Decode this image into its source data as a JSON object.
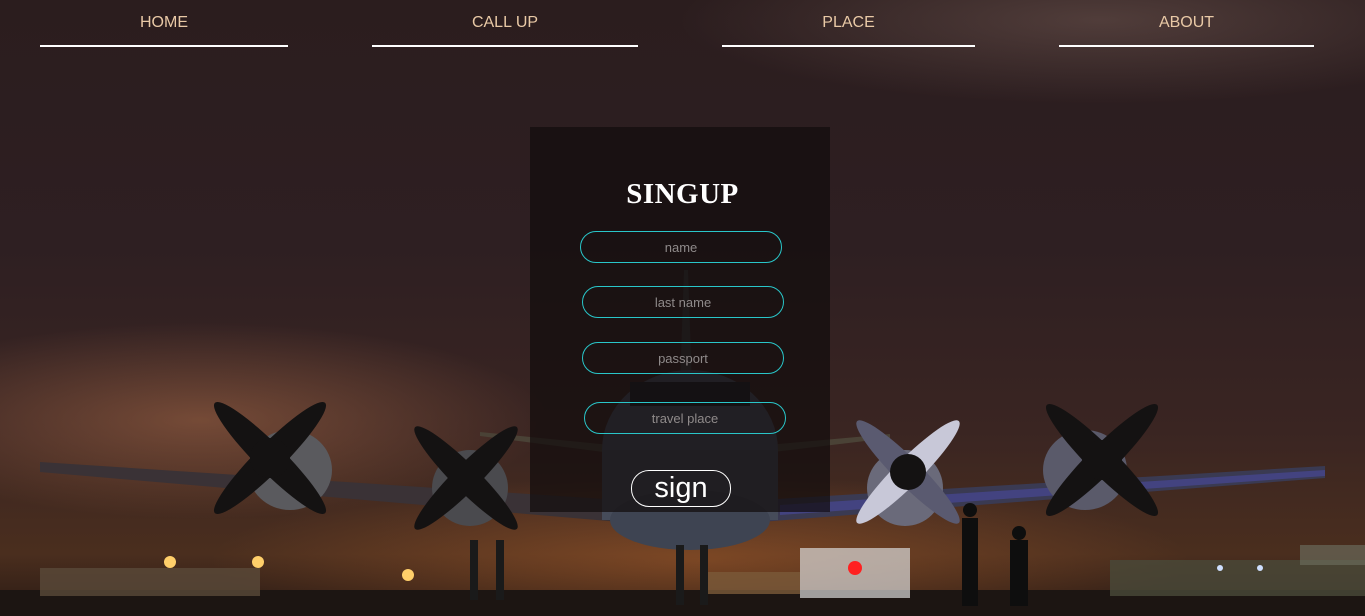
{
  "nav": {
    "items": [
      {
        "label": "HOME"
      },
      {
        "label": "CALL UP"
      },
      {
        "label": "PLACE"
      },
      {
        "label": "ABOUT"
      }
    ]
  },
  "form": {
    "title": "SINGUP",
    "fields": [
      {
        "placeholder": "name",
        "value": ""
      },
      {
        "placeholder": "last name",
        "value": ""
      },
      {
        "placeholder": "passport",
        "value": ""
      },
      {
        "placeholder": "travel place",
        "value": ""
      }
    ],
    "submit_label": "sign"
  },
  "colors": {
    "nav_text": "#e9c9a6",
    "field_border": "#29c6c9",
    "panel_bg": "rgba(18,12,12,0.72)"
  }
}
